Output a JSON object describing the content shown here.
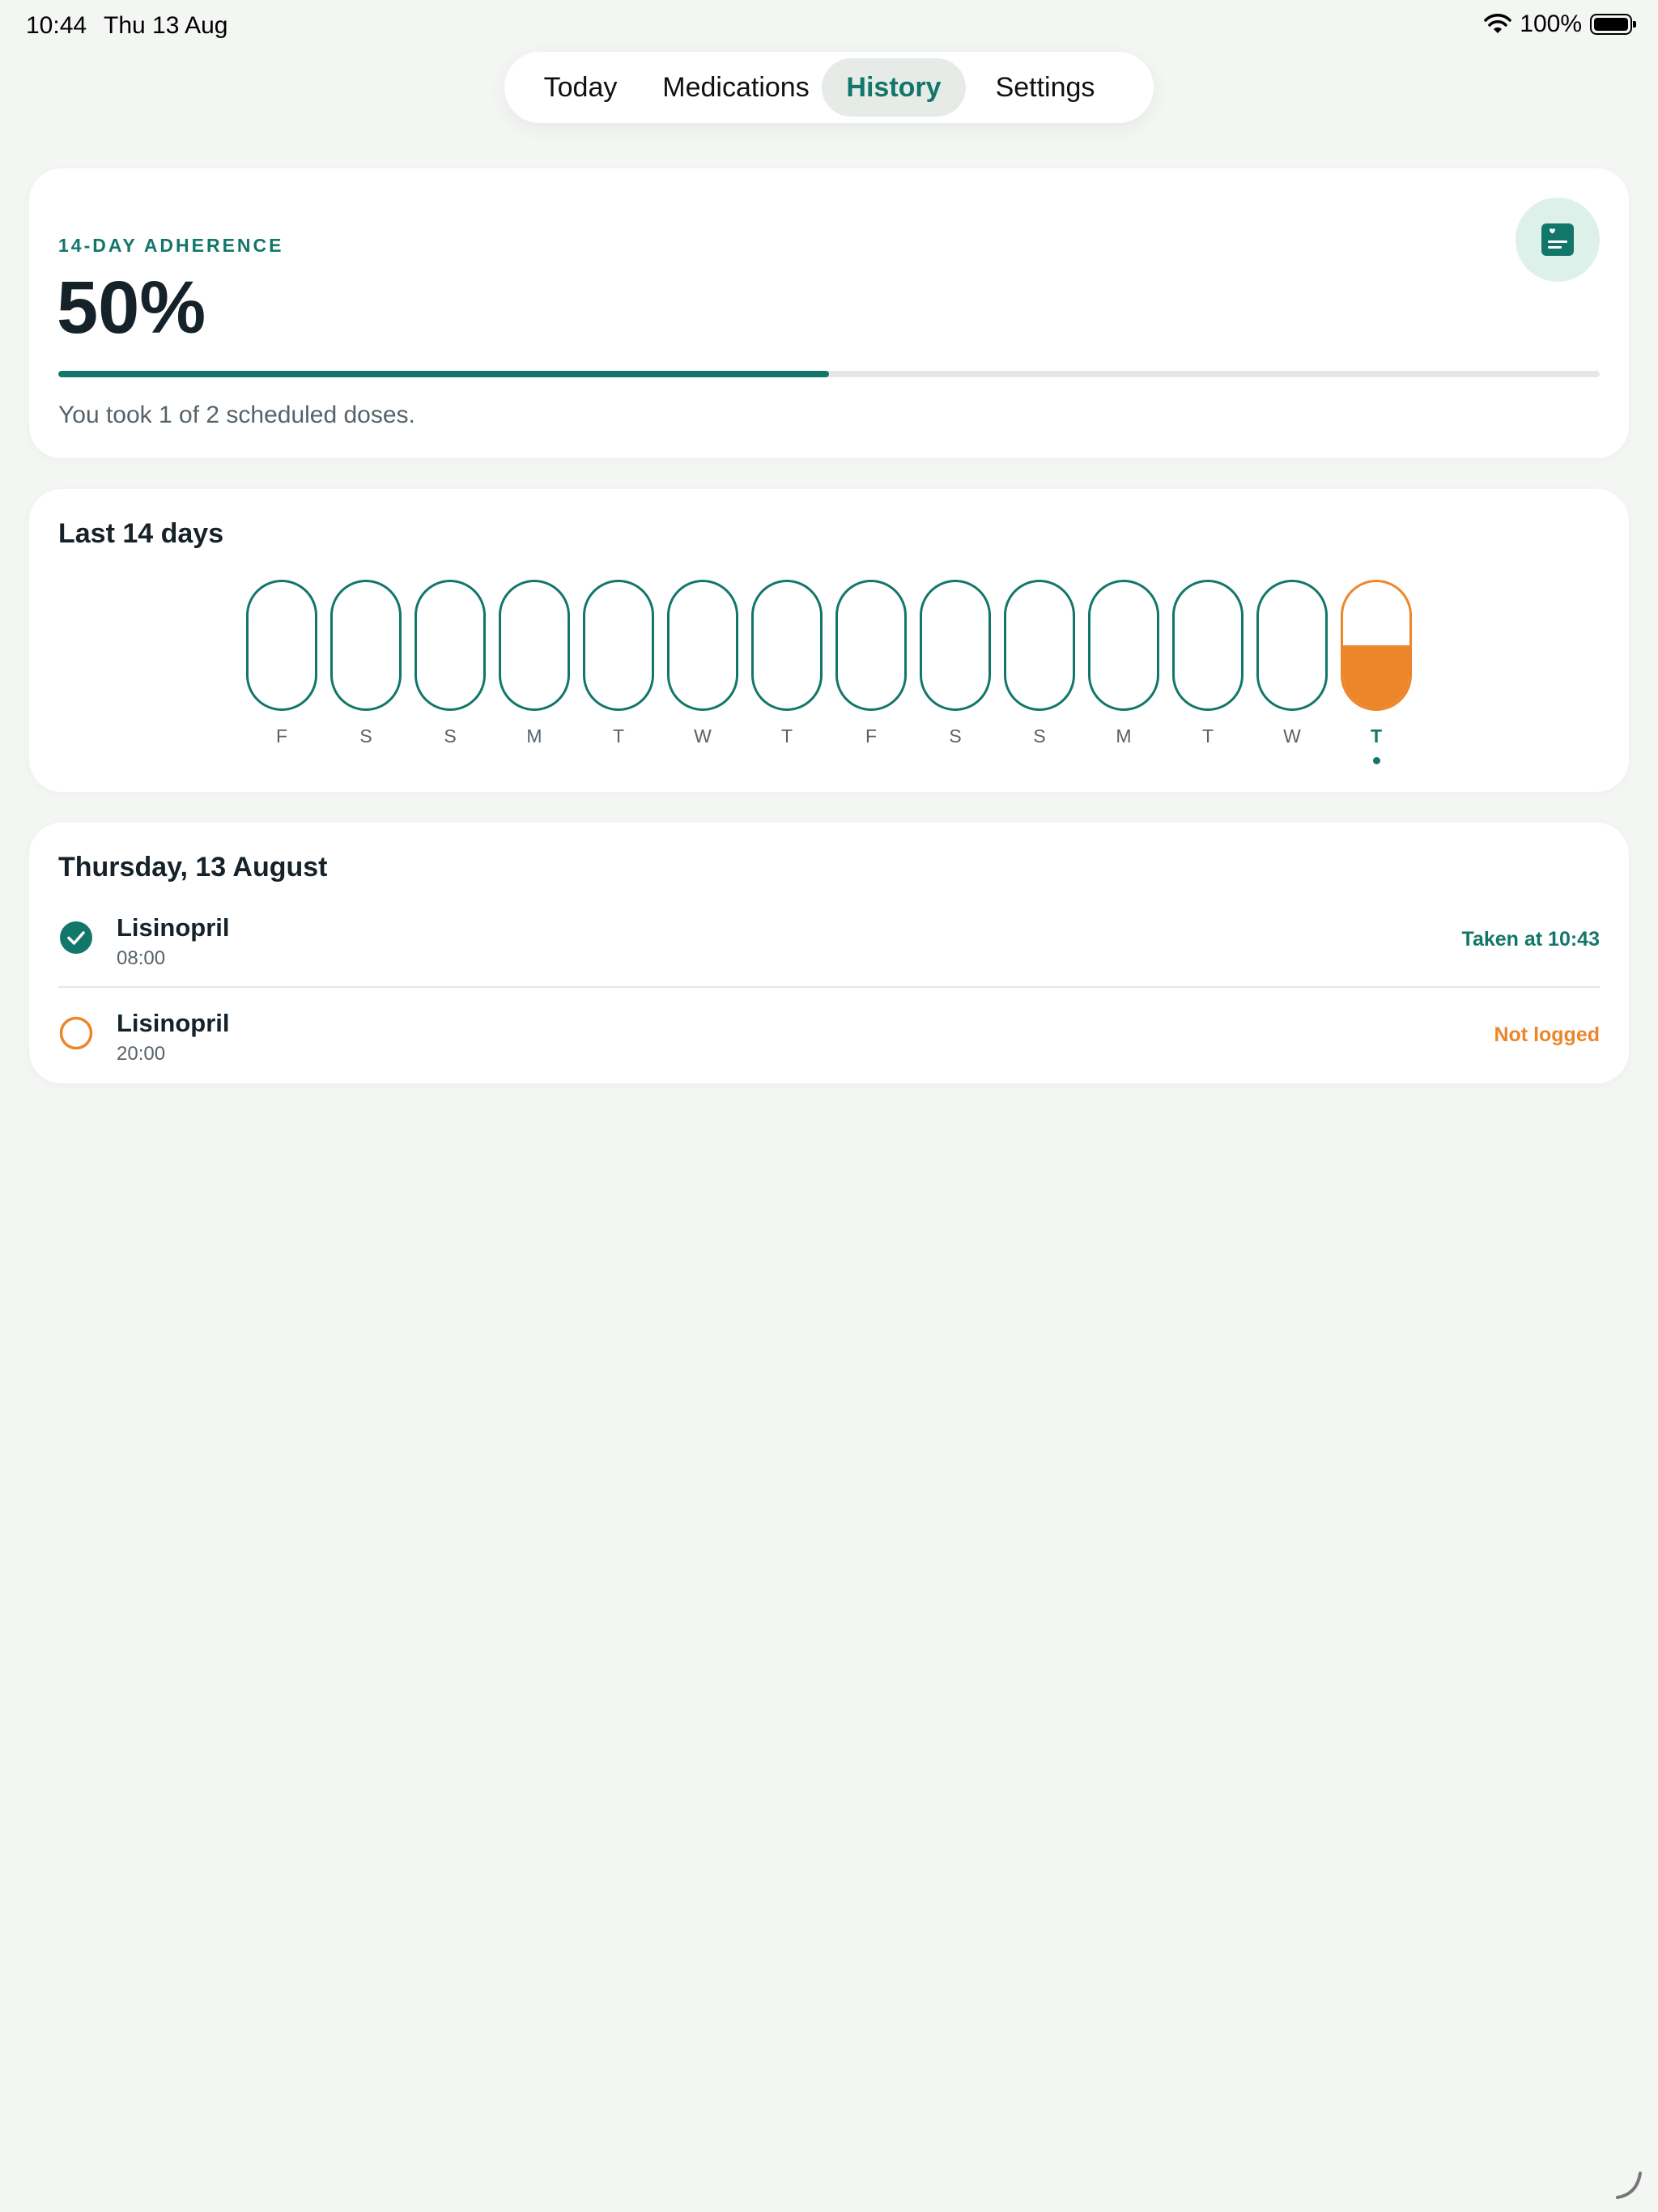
{
  "status_bar": {
    "time": "10:44",
    "date": "Thu 13 Aug",
    "battery": "100%",
    "icons": [
      "wifi-icon",
      "battery-icon"
    ]
  },
  "tabs": [
    {
      "label": "Today",
      "active": false
    },
    {
      "label": "Medications",
      "active": false
    },
    {
      "label": "History",
      "active": true
    },
    {
      "label": "Settings",
      "active": false
    }
  ],
  "adherence": {
    "label": "14-DAY ADHERENCE",
    "percent_text": "50%",
    "progress": 0.5,
    "summary": "You took 1 of 2 scheduled doses.",
    "icon": "report-icon"
  },
  "last_days": {
    "title": "Last 14 days",
    "days": [
      {
        "letter": "F",
        "fill": 0
      },
      {
        "letter": "S",
        "fill": 0
      },
      {
        "letter": "S",
        "fill": 0
      },
      {
        "letter": "M",
        "fill": 0
      },
      {
        "letter": "T",
        "fill": 0
      },
      {
        "letter": "W",
        "fill": 0
      },
      {
        "letter": "T",
        "fill": 0
      },
      {
        "letter": "F",
        "fill": 0
      },
      {
        "letter": "S",
        "fill": 0
      },
      {
        "letter": "S",
        "fill": 0
      },
      {
        "letter": "M",
        "fill": 0
      },
      {
        "letter": "T",
        "fill": 0
      },
      {
        "letter": "W",
        "fill": 0
      },
      {
        "letter": "T",
        "fill": 0.5,
        "today": true
      }
    ]
  },
  "day_detail": {
    "title": "Thursday, 13 August",
    "doses": [
      {
        "name": "Lisinopril",
        "time": "08:00",
        "status": "Taken at 10:43",
        "state": "taken"
      },
      {
        "name": "Lisinopril",
        "time": "20:00",
        "status": "Not logged",
        "state": "missed"
      }
    ]
  },
  "colors": {
    "accent": "#13766a",
    "warning": "#ec862a",
    "background": "#f4f6f4"
  }
}
